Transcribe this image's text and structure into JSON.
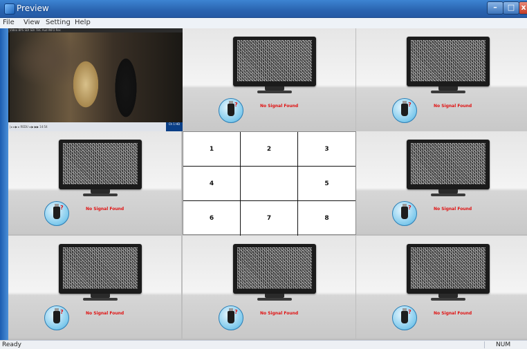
{
  "window": {
    "title": "Preview",
    "minimize": "–",
    "maximize": "□",
    "close": "x"
  },
  "menu": [
    "File",
    "View",
    "Setting",
    "Help"
  ],
  "video": {
    "toolbar": "Video  BPS  SDI  SDI  TBC  Aud  INFO  Rec",
    "status": "|◂  ◂  ▶  ▸  REDU  ◂  ▶  ▶▶  14:54",
    "corner": "Ch 1 HD"
  },
  "no_signal_text": "No Signal Found",
  "tiles": [
    {
      "id": "tile-top-middle"
    },
    {
      "id": "tile-top-right"
    },
    {
      "id": "tile-mid-left"
    },
    {
      "id": "tile-mid-right"
    },
    {
      "id": "tile-bottom-left"
    },
    {
      "id": "tile-bottom-middle"
    },
    {
      "id": "tile-bottom-right"
    }
  ],
  "grid": [
    "1",
    "2",
    "3",
    "4",
    "",
    "5",
    "6",
    "7",
    "8"
  ],
  "status": {
    "left": "Ready",
    "right": "NUM"
  },
  "colors": {
    "title_bar": "#2a64b0",
    "no_signal": "#e01010",
    "left_edge": "#1c5db0"
  }
}
